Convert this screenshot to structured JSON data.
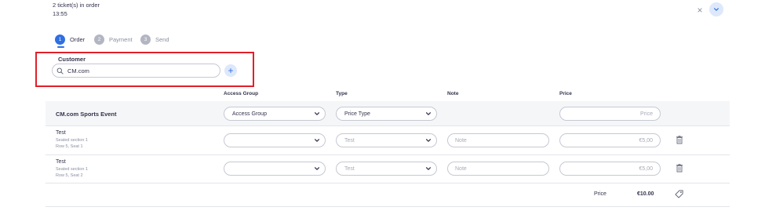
{
  "order": {
    "count_text": "2 ticket(s) in order",
    "time": "13:55"
  },
  "controls": {
    "close_glyph": "×",
    "collapse_icon": "chevron-down-icon"
  },
  "steps": [
    {
      "number": "1",
      "label": "Order",
      "active": true
    },
    {
      "number": "2",
      "label": "Payment",
      "active": false
    },
    {
      "number": "3",
      "label": "Send",
      "active": false
    }
  ],
  "customer": {
    "label": "Customer",
    "search_value": "CM.com",
    "add_glyph": "+"
  },
  "columns": {
    "access_group": "Access Group",
    "type": "Type",
    "note": "Note",
    "price": "Price"
  },
  "event_row": {
    "name": "CM.com Sports Event",
    "access_group_value": "Access Group",
    "type_value": "Price Type",
    "price_placeholder": "Price"
  },
  "tickets": [
    {
      "name": "Test",
      "section": "Seated section 1",
      "seat": "Row 5, Seat 1",
      "access_group_value": "",
      "type_value": "Test",
      "note_placeholder": "Note",
      "price_value": "€5,00"
    },
    {
      "name": "Test",
      "section": "Seated section 1",
      "seat": "Row 5, Seat 2",
      "access_group_value": "",
      "type_value": "Test",
      "note_placeholder": "Note",
      "price_value": "€5,00"
    }
  ],
  "total": {
    "label": "Price",
    "value": "€10.00"
  },
  "colors": {
    "accent": "#2f6fe0",
    "highlight_border": "#e0202a",
    "text": "#33334d",
    "muted": "#8a8fa3"
  }
}
